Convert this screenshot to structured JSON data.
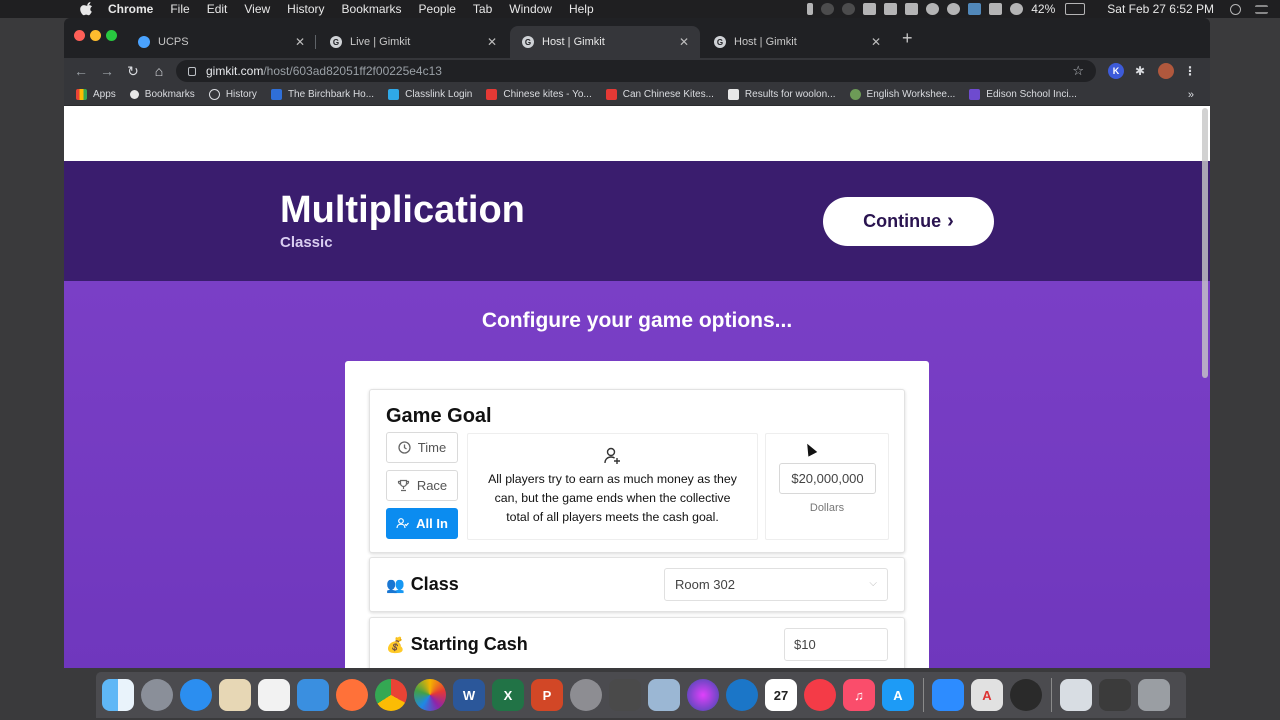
{
  "menubar": {
    "items": [
      "Chrome",
      "File",
      "Edit",
      "View",
      "History",
      "Bookmarks",
      "People",
      "Tab",
      "Window",
      "Help"
    ],
    "battery": "42%",
    "datetime": "Sat Feb 27  6:52 PM"
  },
  "tabs": [
    {
      "label": "UCPS"
    },
    {
      "label": "Live | Gimkit"
    },
    {
      "label": "Host | Gimkit"
    },
    {
      "label": "Host | Gimkit"
    }
  ],
  "toolbar": {
    "url_host": "gimkit.com",
    "url_path": "/host/603ad82051ff2f00225e4c13",
    "ext_k": "K"
  },
  "bookmarks": [
    {
      "label": "Apps"
    },
    {
      "label": "Bookmarks"
    },
    {
      "label": "History"
    },
    {
      "label": "The Birchbark Ho..."
    },
    {
      "label": "Classlink Login"
    },
    {
      "label": "Chinese kites - Yo..."
    },
    {
      "label": "Can Chinese Kites..."
    },
    {
      "label": "Results for woolon..."
    },
    {
      "label": "English Workshee..."
    },
    {
      "label": "Edison School Inci..."
    }
  ],
  "bookmarks_more": "»",
  "page": {
    "title": "Multiplication",
    "subtitle": "Classic",
    "continue_label": "Continue",
    "configure_heading": "Configure your game options...",
    "game_goal": {
      "title": "Game Goal",
      "modes": [
        {
          "label": "Time",
          "active": false
        },
        {
          "label": "Race",
          "active": false
        },
        {
          "label": "All In",
          "active": true
        }
      ],
      "description": "All players try to earn as much money as they can, but the game ends when the collective total of all players meets the cash goal.",
      "goal_value": "$20,000,000",
      "goal_unit": "Dollars"
    },
    "class": {
      "emoji": "👥",
      "title": "Class",
      "selected": "Room 302"
    },
    "starting_cash": {
      "emoji": "💰",
      "title": "Starting Cash",
      "value": "$10"
    }
  },
  "colors": {
    "hero": "#3a1d6e",
    "page_purple": "#7a3fc6",
    "active_mode": "#0b8cf0"
  }
}
